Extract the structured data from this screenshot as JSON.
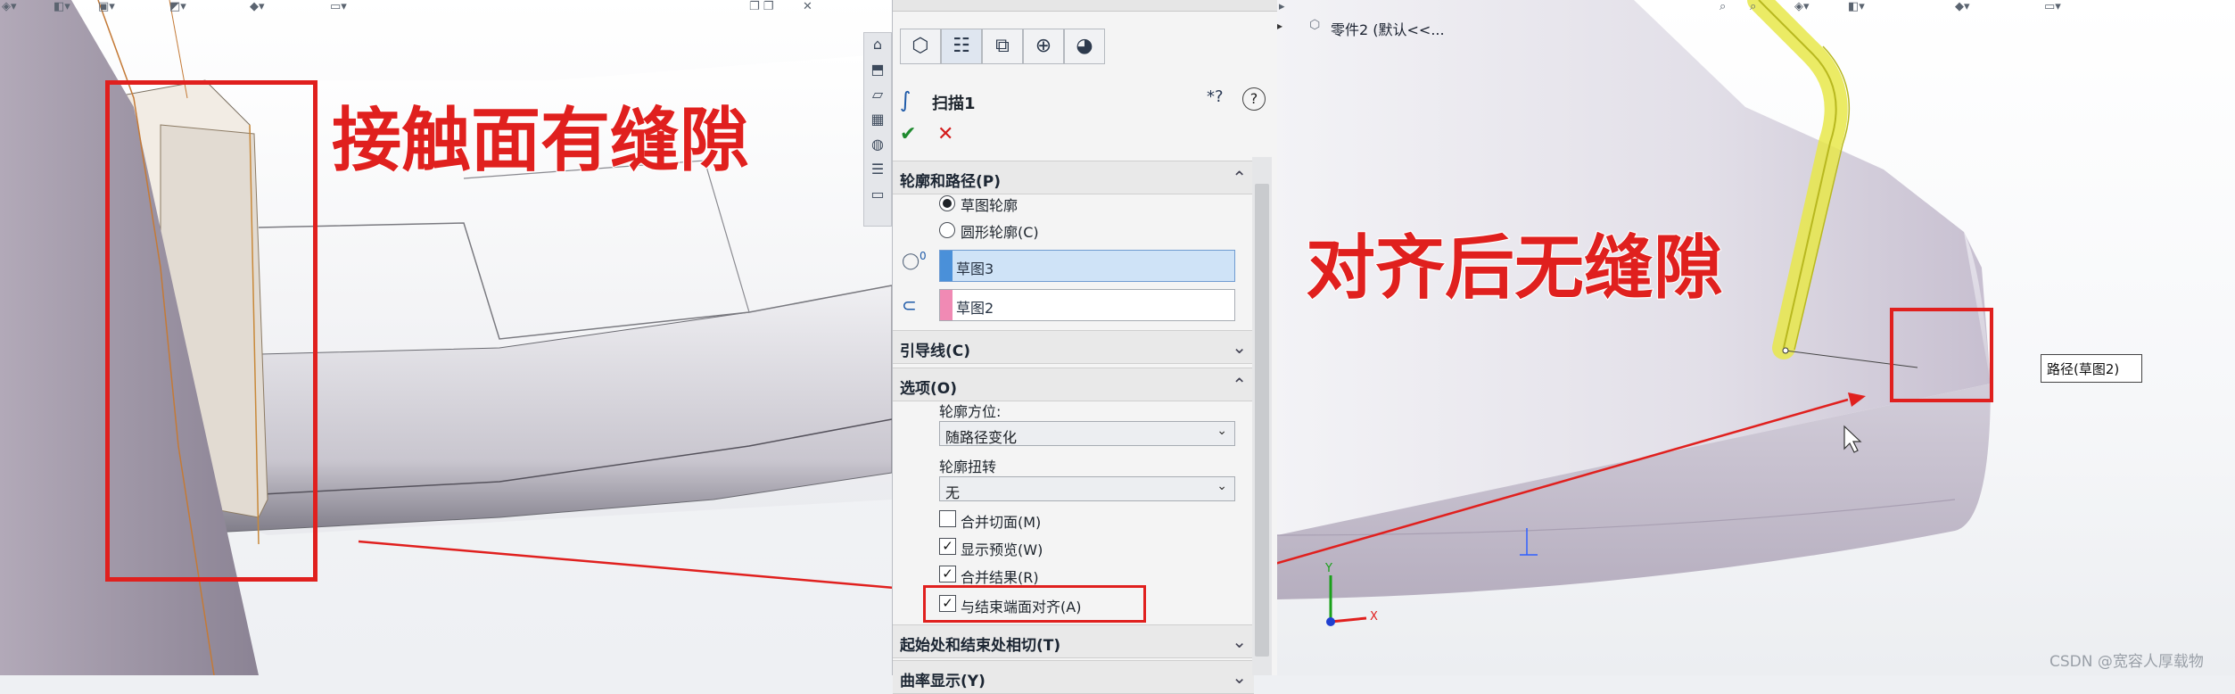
{
  "feature_tree": {
    "part_label": "零件2 (默认<<..."
  },
  "property_manager": {
    "feature_title": "扫描1",
    "help_icons": "*?",
    "sections": {
      "profile_path": {
        "title": "轮廓和路径(P)",
        "radio_sketch_profile": "草图轮廓",
        "radio_circular_profile": "圆形轮廓(C)",
        "profile_field": "草图3",
        "path_field": "草图2",
        "profile_marker": "0"
      },
      "guide_curves": {
        "title": "引导线(C)"
      },
      "options": {
        "title": "选项(O)",
        "profile_orientation_label": "轮廓方位:",
        "profile_orientation_value": "随路径变化",
        "profile_twist_label": "轮廓扭转",
        "profile_twist_value": "无",
        "merge_tangent_faces": "合并切面(M)",
        "show_preview": "显示预览(W)",
        "merge_result": "合并结果(R)",
        "align_with_end_faces": "与结束端面对齐(A)"
      },
      "start_end_tangency": {
        "title": "起始处和结束处相切(T)"
      },
      "curvature_display": {
        "title": "曲率显示(Y)"
      }
    }
  },
  "annotations": {
    "left_caption": "接触面有缝隙",
    "right_caption": "对齐后无缝隙",
    "path_callout": "路径(草图2)"
  },
  "triad": {
    "x_label": "X",
    "y_label": "Y"
  },
  "watermark": "CSDN @宽容人厚载物",
  "colors": {
    "annotation_red": "#e0201e",
    "selection_blue": "#cfe3f7",
    "profile_swatch": "#4a90d9",
    "path_swatch": "#f08ab4",
    "sweep_yellow": "#e7e84a"
  }
}
